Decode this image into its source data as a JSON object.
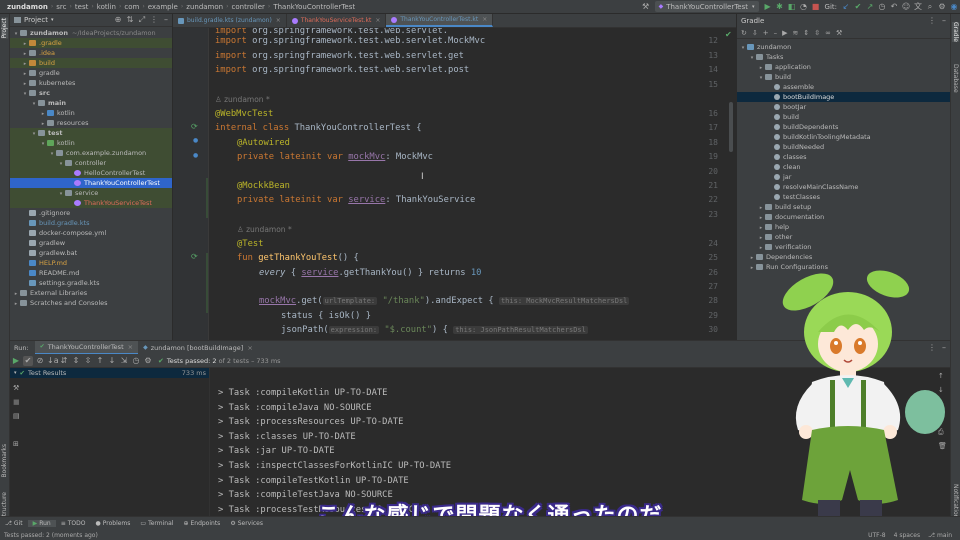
{
  "titlebar": {
    "breadcrumbs": [
      "zundamon",
      "src",
      "test",
      "kotlin",
      "com",
      "example",
      "zundamon",
      "controller",
      "ThankYouControllerTest"
    ],
    "run_config": "ThankYouControllerTest",
    "git_label": "Git:"
  },
  "project_panel": {
    "title": "Project",
    "items": [
      {
        "label": "zundamon",
        "extra": "~/IdeaProjects/zundamon",
        "level": 0,
        "arrow": "▾",
        "icon": "folder",
        "state": ""
      },
      {
        "label": ".gradle",
        "level": 1,
        "arrow": "▸",
        "icon": "folder-orange",
        "state": "hl",
        "color": "#d9a343"
      },
      {
        "label": ".idea",
        "level": 1,
        "arrow": "▸",
        "icon": "folder",
        "state": "",
        "color": "#d9a343"
      },
      {
        "label": "build",
        "level": 1,
        "arrow": "▸",
        "icon": "folder-orange",
        "state": "hl",
        "color": "#d9a343"
      },
      {
        "label": "gradle",
        "level": 1,
        "arrow": "▸",
        "icon": "folder",
        "state": ""
      },
      {
        "label": "kubernetes",
        "level": 1,
        "arrow": "▸",
        "icon": "folder",
        "state": ""
      },
      {
        "label": "src",
        "level": 1,
        "arrow": "▾",
        "icon": "folder",
        "state": ""
      },
      {
        "label": "main",
        "level": 2,
        "arrow": "▾",
        "icon": "folder",
        "state": ""
      },
      {
        "label": "kotlin",
        "level": 3,
        "arrow": "▸",
        "icon": "folder-blue",
        "state": ""
      },
      {
        "label": "resources",
        "level": 3,
        "arrow": "▸",
        "icon": "folder",
        "state": ""
      },
      {
        "label": "test",
        "level": 2,
        "arrow": "▾",
        "icon": "folder",
        "state": "hl"
      },
      {
        "label": "kotlin",
        "level": 3,
        "arrow": "▾",
        "icon": "folder-green",
        "state": "hl"
      },
      {
        "label": "com.example.zundamon",
        "level": 4,
        "arrow": "▾",
        "icon": "package",
        "state": "hl"
      },
      {
        "label": "controller",
        "level": 5,
        "arrow": "▾",
        "icon": "package",
        "state": "hl"
      },
      {
        "label": "HelloControllerTest",
        "level": 6,
        "arrow": "",
        "icon": "kotlin",
        "state": "hl"
      },
      {
        "label": "ThankYouControllerTest",
        "level": 6,
        "arrow": "",
        "icon": "kotlin",
        "state": "sel"
      },
      {
        "label": "service",
        "level": 5,
        "arrow": "▾",
        "icon": "package",
        "state": "hl"
      },
      {
        "label": "ThankYouServiceTest",
        "level": 6,
        "arrow": "",
        "icon": "kotlin",
        "state": "hl",
        "color": "#e06c5a"
      },
      {
        "label": ".gitignore",
        "level": 1,
        "arrow": "",
        "icon": "file",
        "state": ""
      },
      {
        "label": "build.gradle.kts",
        "level": 1,
        "arrow": "",
        "icon": "gradle",
        "state": "",
        "color": "#6897bb"
      },
      {
        "label": "docker-compose.yml",
        "level": 1,
        "arrow": "",
        "icon": "file",
        "state": ""
      },
      {
        "label": "gradlew",
        "level": 1,
        "arrow": "",
        "icon": "file",
        "state": ""
      },
      {
        "label": "gradlew.bat",
        "level": 1,
        "arrow": "",
        "icon": "file",
        "state": ""
      },
      {
        "label": "HELP.md",
        "level": 1,
        "arrow": "",
        "icon": "md",
        "state": "",
        "color": "#d9a343"
      },
      {
        "label": "README.md",
        "level": 1,
        "arrow": "",
        "icon": "md",
        "state": ""
      },
      {
        "label": "settings.gradle.kts",
        "level": 1,
        "arrow": "",
        "icon": "gradle",
        "state": ""
      },
      {
        "label": "External Libraries",
        "level": 0,
        "arrow": "▸",
        "icon": "lib",
        "state": ""
      },
      {
        "label": "Scratches and Consoles",
        "level": 0,
        "arrow": "▸",
        "icon": "scratch",
        "state": ""
      }
    ]
  },
  "editor_tabs": [
    {
      "label": "build.gradle.kts (zundamon)",
      "color": "#6897bb",
      "active": false
    },
    {
      "label": "ThankYouServiceTest.kt",
      "color": "#e06c5a",
      "active": false
    },
    {
      "label": "ThankYouControllerTest.kt",
      "color": "#6897bb",
      "active": true
    }
  ],
  "code": {
    "line_numbers": [
      "12",
      "13",
      "14",
      "15",
      "16",
      "17",
      "18",
      "19",
      "20",
      "21",
      "22",
      "23",
      "24",
      "25",
      "26",
      "27",
      "28",
      "29",
      "30"
    ],
    "line12": "import org.springframework.test.web.servlet.MockMvc",
    "imp_kw": "import",
    "line13": "org.springframework.test.web.servlet.MockMvc",
    "line14": "org.springframework.test.web.servlet.get",
    "line15": "org.springframework.test.web.servlet.post",
    "author": "zundamon *",
    "ann_webmvc": "@WebMvcTest",
    "internal_class": "internal class",
    "class_name": "ThankYouControllerTest {",
    "ann_autowired": "@Autowired",
    "private_lateinit_var": "private lateinit var",
    "mockmvc_field": "mockMvc",
    "mockmvc_type": ": MockMvc",
    "ann_mockkbean": "@MockkBean",
    "service_field": "service",
    "service_type": ": ThankYouService",
    "ann_test": "@Test",
    "fun_kw": "fun",
    "fun_name": "getThankYouTest",
    "fun_rest": "() {",
    "every_fn": "every",
    "every_open": " { ",
    "every_call": ".getThankYou() } returns ",
    "every_num": "10",
    "mockmvc_call": "mockMvc",
    "get_fn": ".get(",
    "hint_url": "urlTemplate:",
    "thank_str": "\"/thank\"",
    "andexpect": ").andExpect {",
    "hint_dsl1": "this: MockMvcResultMatchersDsl",
    "status_line": "status { isOk() }",
    "jsonpath": "jsonPath(",
    "hint_expr": "expression:",
    "count_str": "\"$.count\"",
    "jsonpath_rest": ") {",
    "hint_dsl2": "this: JsonPathResultMatchersDsl"
  },
  "gradle_panel": {
    "title": "Gradle",
    "items": [
      {
        "label": "zundamon",
        "level": 0,
        "arrow": "▾",
        "state": ""
      },
      {
        "label": "Tasks",
        "level": 1,
        "arrow": "▾",
        "state": ""
      },
      {
        "label": "application",
        "level": 2,
        "arrow": "▸",
        "state": ""
      },
      {
        "label": "build",
        "level": 2,
        "arrow": "▾",
        "state": ""
      },
      {
        "label": "assemble",
        "level": 3,
        "arrow": "",
        "state": ""
      },
      {
        "label": "bootBuildImage",
        "level": 3,
        "arrow": "",
        "state": "sel"
      },
      {
        "label": "bootJar",
        "level": 3,
        "arrow": "",
        "state": ""
      },
      {
        "label": "build",
        "level": 3,
        "arrow": "",
        "state": ""
      },
      {
        "label": "buildDependents",
        "level": 3,
        "arrow": "",
        "state": ""
      },
      {
        "label": "buildKotlinToolingMetadata",
        "level": 3,
        "arrow": "",
        "state": ""
      },
      {
        "label": "buildNeeded",
        "level": 3,
        "arrow": "",
        "state": ""
      },
      {
        "label": "classes",
        "level": 3,
        "arrow": "",
        "state": ""
      },
      {
        "label": "clean",
        "level": 3,
        "arrow": "",
        "state": ""
      },
      {
        "label": "jar",
        "level": 3,
        "arrow": "",
        "state": ""
      },
      {
        "label": "resolveMainClassName",
        "level": 3,
        "arrow": "",
        "state": ""
      },
      {
        "label": "testClasses",
        "level": 3,
        "arrow": "",
        "state": ""
      },
      {
        "label": "build setup",
        "level": 2,
        "arrow": "▸",
        "state": ""
      },
      {
        "label": "documentation",
        "level": 2,
        "arrow": "▸",
        "state": ""
      },
      {
        "label": "help",
        "level": 2,
        "arrow": "▸",
        "state": ""
      },
      {
        "label": "other",
        "level": 2,
        "arrow": "▸",
        "state": ""
      },
      {
        "label": "verification",
        "level": 2,
        "arrow": "▸",
        "state": ""
      },
      {
        "label": "Dependencies",
        "level": 1,
        "arrow": "▸",
        "state": ""
      },
      {
        "label": "Run Configurations",
        "level": 1,
        "arrow": "▸",
        "state": ""
      }
    ]
  },
  "run_panel": {
    "label": "Run:",
    "tabs": [
      "ThankYouControllerTest",
      "zundamon [bootBuildImage]"
    ],
    "tests_passed": "Tests passed: 2 of 2 tests – 733 ms",
    "tests_passed_bold": "Tests passed: 2",
    "tests_passed_rest": " of 2 tests – 733 ms",
    "test_results_label": "Test Results",
    "test_results_time": "733 ms",
    "console_lines": [
      "> Task :compileKotlin UP-TO-DATE",
      "> Task :compileJava NO-SOURCE",
      "> Task :processResources UP-TO-DATE",
      "> Task :classes UP-TO-DATE",
      "> Task :jar UP-TO-DATE",
      "> Task :inspectClassesForKotlinIC UP-TO-DATE",
      "> Task :compileTestKotlin UP-TO-DATE",
      "> Task :compileTestJava NO-SOURCE",
      "> Task :processTestResources NO-SOURCE"
    ]
  },
  "bottom_toolbar": [
    {
      "label": "Git",
      "icon": "⎇"
    },
    {
      "label": "Run",
      "icon": "▶",
      "active": true
    },
    {
      "label": "TODO",
      "icon": "≡"
    },
    {
      "label": "Problems",
      "icon": "●"
    },
    {
      "label": "Terminal",
      "icon": "▭"
    },
    {
      "label": "Endpoints",
      "icon": "⊕"
    },
    {
      "label": "Services",
      "icon": "⚙"
    }
  ],
  "status": {
    "left": "Tests passed: 2 (moments ago)",
    "encoding": "UTF-8",
    "indent": "4 spaces",
    "branch": "main"
  },
  "side_tabs": {
    "left_top": "Project",
    "left_bottom_1": "Bookmarks",
    "left_bottom_2": "Structure",
    "right_top_1": "Gradle",
    "right_top_2": "Database",
    "right_bottom": "Notifications"
  },
  "subtitle": "こんな感じで問題なく通ったのだ",
  "colors": {
    "accent": "#2f65ca",
    "test_pass": "#5fa65a",
    "run_green": "#59a869"
  }
}
